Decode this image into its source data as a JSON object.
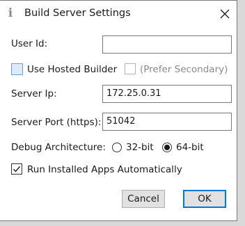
{
  "window": {
    "title": "Build Server Settings",
    "icon": "info-icon",
    "close_icon": "close-icon"
  },
  "user_id": {
    "label": "User Id:",
    "value": ""
  },
  "hosted_builder": {
    "label": "Use Hosted Builder",
    "checked": false
  },
  "prefer_secondary": {
    "label": "(Prefer Secondary)",
    "checked": false,
    "enabled": false
  },
  "server_ip": {
    "label": "Server Ip:",
    "value": "172.25.0.31"
  },
  "server_port": {
    "label": "Server Port (https):",
    "value": "51042"
  },
  "debug_architecture": {
    "label": "Debug Architecture:",
    "options": [
      {
        "label": "32-bit",
        "selected": false
      },
      {
        "label": "64-bit",
        "selected": true
      }
    ]
  },
  "run_installed_apps": {
    "label": "Run Installed Apps Automatically",
    "checked": true
  },
  "buttons": {
    "cancel": "Cancel",
    "ok": "OK"
  },
  "colors": {
    "accent": "#0078d7",
    "checkbox_highlight": "#dfeaf7"
  }
}
